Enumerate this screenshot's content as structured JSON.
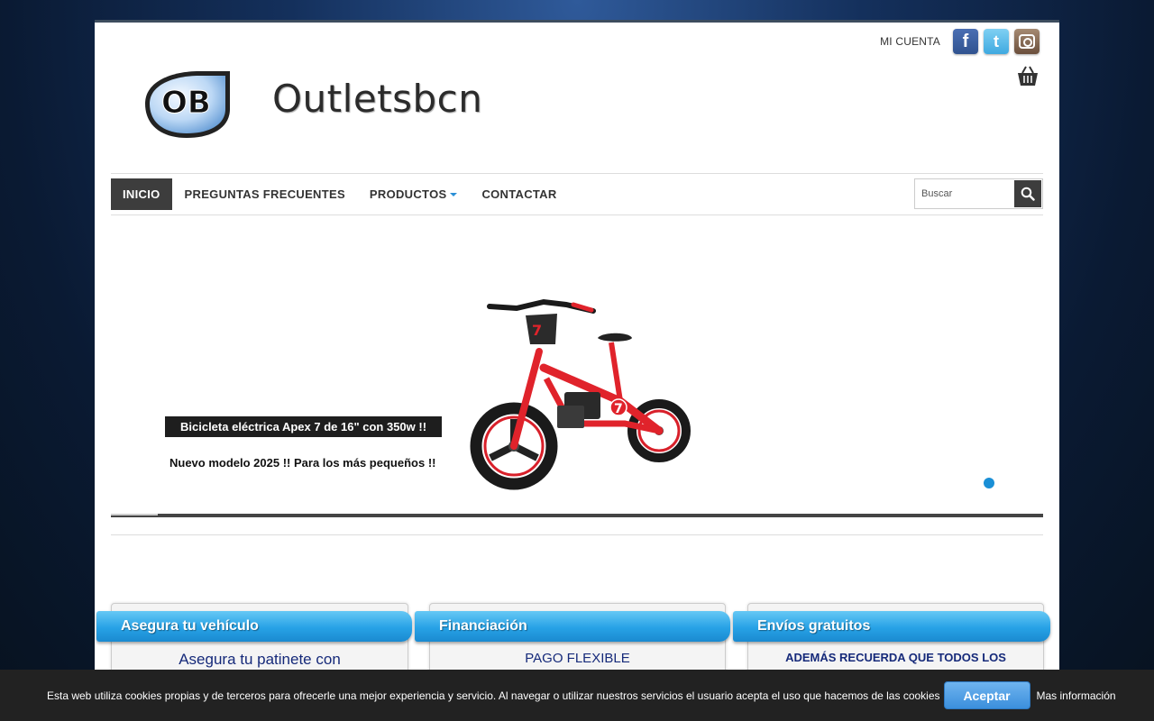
{
  "header": {
    "account_label": "MI CUENTA",
    "social": [
      {
        "name": "facebook",
        "glyph": "f"
      },
      {
        "name": "twitter",
        "glyph": "t"
      },
      {
        "name": "instagram",
        "glyph": ""
      }
    ],
    "brand": "Outletsbcn",
    "logo_text": "OB"
  },
  "nav": {
    "items": [
      {
        "label": "INICIO",
        "active": true
      },
      {
        "label": "PREGUNTAS FRECUENTES"
      },
      {
        "label": "PRODUCTOS",
        "dropdown": true
      },
      {
        "label": "CONTACTAR"
      }
    ],
    "search_placeholder": "Buscar"
  },
  "slider": {
    "title": "Bicicleta eléctrica Apex 7 de 16\" con 350w !!",
    "subtitle": "Nuevo modelo 2025 !! Para los más pequeños !!",
    "bike_number": "7",
    "progress": 0.05
  },
  "boxes": [
    {
      "title": "Asegura tu vehículo",
      "text": "Asegura tu patinete con"
    },
    {
      "title": "Financiación",
      "text": "PAGO FLEXIBLE"
    },
    {
      "title": "Envíos gratuitos",
      "text": "ADEMÁS RECUERDA QUE TODOS LOS"
    }
  ],
  "cookie": {
    "text": "Esta web utiliza cookies propias y de terceros para ofrecerle una mejor experiencia y servicio. Al navegar o utilizar nuestros servicios el usuario acepta el uso que hacemos de las cookies",
    "accept_label": "Aceptar",
    "more_label": "Mas información"
  },
  "colors": {
    "accent": "#1a8fd6",
    "nav_active": "#3d3d3d",
    "box_text": "#162a7a"
  }
}
